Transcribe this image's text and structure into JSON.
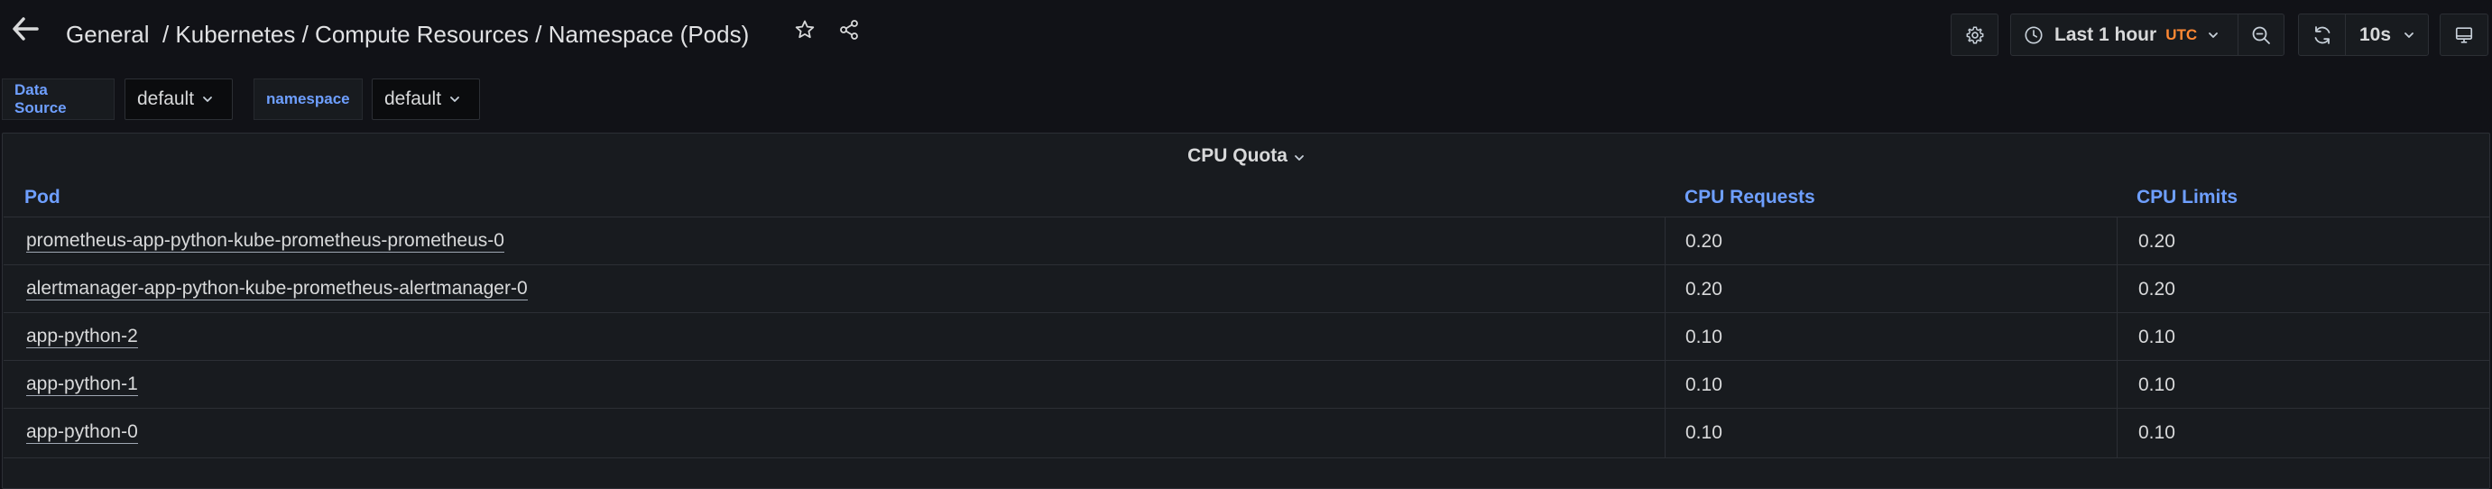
{
  "header": {
    "breadcrumb": "General  / Kubernetes / Compute Resources / Namespace (Pods)",
    "time_range_label": "Last 1 hour",
    "timezone_label": "UTC",
    "refresh_interval_label": "10s"
  },
  "variables": [
    {
      "label": "Data Source",
      "value": "default"
    },
    {
      "label": "namespace",
      "value": "default"
    }
  ],
  "panel": {
    "title": "CPU Quota",
    "columns": [
      "Pod",
      "CPU Requests",
      "CPU Limits"
    ],
    "rows": [
      {
        "pod": "prometheus-app-python-kube-prometheus-prometheus-0",
        "cpu_requests": "0.20",
        "cpu_limits": "0.20"
      },
      {
        "pod": "alertmanager-app-python-kube-prometheus-alertmanager-0",
        "cpu_requests": "0.20",
        "cpu_limits": "0.20"
      },
      {
        "pod": "app-python-2",
        "cpu_requests": "0.10",
        "cpu_limits": "0.10"
      },
      {
        "pod": "app-python-1",
        "cpu_requests": "0.10",
        "cpu_limits": "0.10"
      },
      {
        "pod": "app-python-0",
        "cpu_requests": "0.10",
        "cpu_limits": "0.10"
      }
    ]
  },
  "icons": {
    "back": "arrow-left-icon",
    "star": "star-icon",
    "share": "share-icon",
    "settings": "gear-icon",
    "clock": "clock-icon",
    "zoom_out": "zoom-out-icon",
    "refresh": "refresh-icon",
    "tv": "monitor-icon"
  },
  "colors": {
    "background": "#111217",
    "panel": "#181b1f",
    "link_header": "#6e9fff",
    "utc_accent": "#ff8833",
    "text": "#d8d9da"
  }
}
